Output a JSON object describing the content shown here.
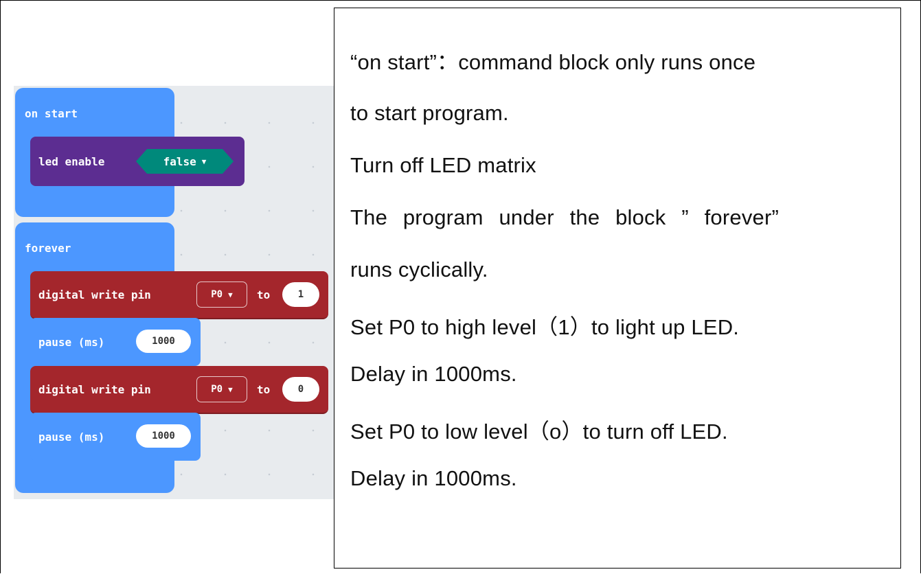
{
  "blocks": {
    "on_start": {
      "label": "on start",
      "led_enable": {
        "label": "led enable",
        "value": "false"
      }
    },
    "forever": {
      "label": "forever",
      "write_1": {
        "label": "digital write pin",
        "pin": "P0",
        "to": "to",
        "value": "1"
      },
      "pause_1": {
        "label": "pause (ms)",
        "value": "1000"
      },
      "write_2": {
        "label": "digital write pin",
        "pin": "P0",
        "to": "to",
        "value": "0"
      },
      "pause_2": {
        "label": "pause (ms)",
        "value": "1000"
      }
    }
  },
  "colors": {
    "basic_blue": "#4c97ff",
    "led_purple": "#5c2d91",
    "pins_red": "#a4262c",
    "logic_teal": "#00897b",
    "workspace": "#e8ebee"
  },
  "explanation": {
    "lines": [
      "“on start”：command block only runs once",
      "to start program.",
      "Turn off LED matrix",
      "The program under the block ” forever”",
      "runs cyclically.",
      "Set P0 to high level（1）to light up LED.",
      "Delay in 1000ms.",
      "Set P0 to low level（o）to turn off LED.",
      "Delay in 1000ms."
    ]
  }
}
